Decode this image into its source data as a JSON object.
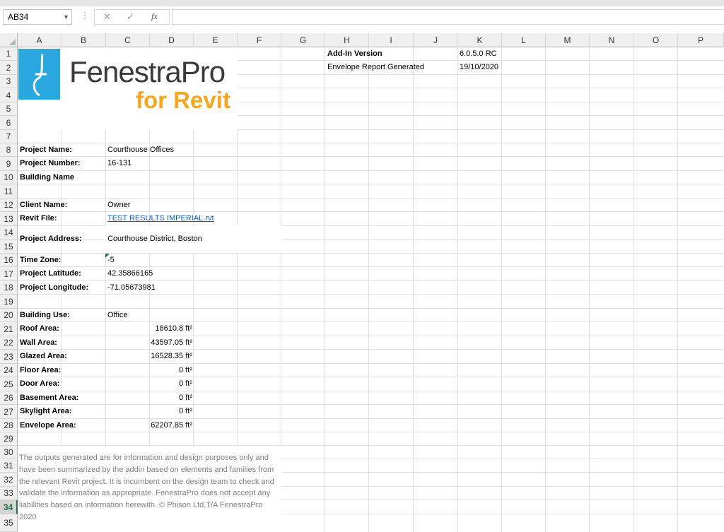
{
  "formula_bar": {
    "name_box": "AB34",
    "separator": "⋮",
    "cancel_icon": "✕",
    "enter_icon": "✓",
    "fx_label": "fx",
    "formula": ""
  },
  "columns": [
    "A",
    "B",
    "C",
    "D",
    "E",
    "F",
    "G",
    "H",
    "I",
    "J",
    "K",
    "L",
    "M",
    "N",
    "O",
    "P"
  ],
  "rows": [
    "1",
    "2",
    "3",
    "4",
    "5",
    "6",
    "7",
    "8",
    "9",
    "10",
    "11",
    "12",
    "13",
    "14",
    "15",
    "16",
    "17",
    "18",
    "19",
    "20",
    "21",
    "22",
    "23",
    "24",
    "25",
    "26",
    "27",
    "28",
    "29",
    "30",
    "31",
    "32",
    "33",
    "34",
    "35"
  ],
  "selected_row": "34",
  "logo": {
    "line1": "FenestraPro",
    "line2": "for Revit"
  },
  "info": {
    "addin_label": "Add-In Version",
    "addin_value": "6.0.5.0  RC",
    "report_label": "Envelope Report Generated",
    "report_value": "19/10/2020"
  },
  "project": {
    "project_name_label": "Project Name:",
    "project_name": "Courthouse Offices",
    "project_number_label": "Project Number:",
    "project_number": "16-131",
    "building_name_label": "Building Name",
    "client_name_label": "Client Name:",
    "client_name": "Owner",
    "revit_file_label": "Revit File:",
    "revit_file": "TEST RESULTS IMPERIAL.rvt",
    "address_label": "Project Address:",
    "address": "Courthouse District, Boston",
    "time_zone_label": "Time Zone:",
    "time_zone": "-5",
    "latitude_label": "Project Latitude:",
    "latitude": "42.35866165",
    "longitude_label": "Project Longitude:",
    "longitude": "-71.05673981",
    "building_use_label": "Building Use:",
    "building_use": "Office"
  },
  "areas": [
    {
      "label": "Roof Area:",
      "value": "18610.8 ft²"
    },
    {
      "label": "Wall Area:",
      "value": "43597.05 ft²"
    },
    {
      "label": "Glazed Area:",
      "value": "16528.35 ft²"
    },
    {
      "label": "Floor Area:",
      "value": "0 ft²"
    },
    {
      "label": "Door Area:",
      "value": "0 ft²"
    },
    {
      "label": "Basement Area:",
      "value": "0 ft²"
    },
    {
      "label": "Skylight Area:",
      "value": "0 ft²"
    },
    {
      "label": "Envelope Area:",
      "value": "62207.85 ft²"
    }
  ],
  "disclaimer": "The outputs generated are for information and design purposes only and have been summarized by the addin based on elements and families from the relevant Revit project. It is incumbent on the design team to check and validate the information as appropriate. FenestraPro does not accept any liabilities based on information herewith. © Phison Ltd,T/A FenestraPro 2020"
}
